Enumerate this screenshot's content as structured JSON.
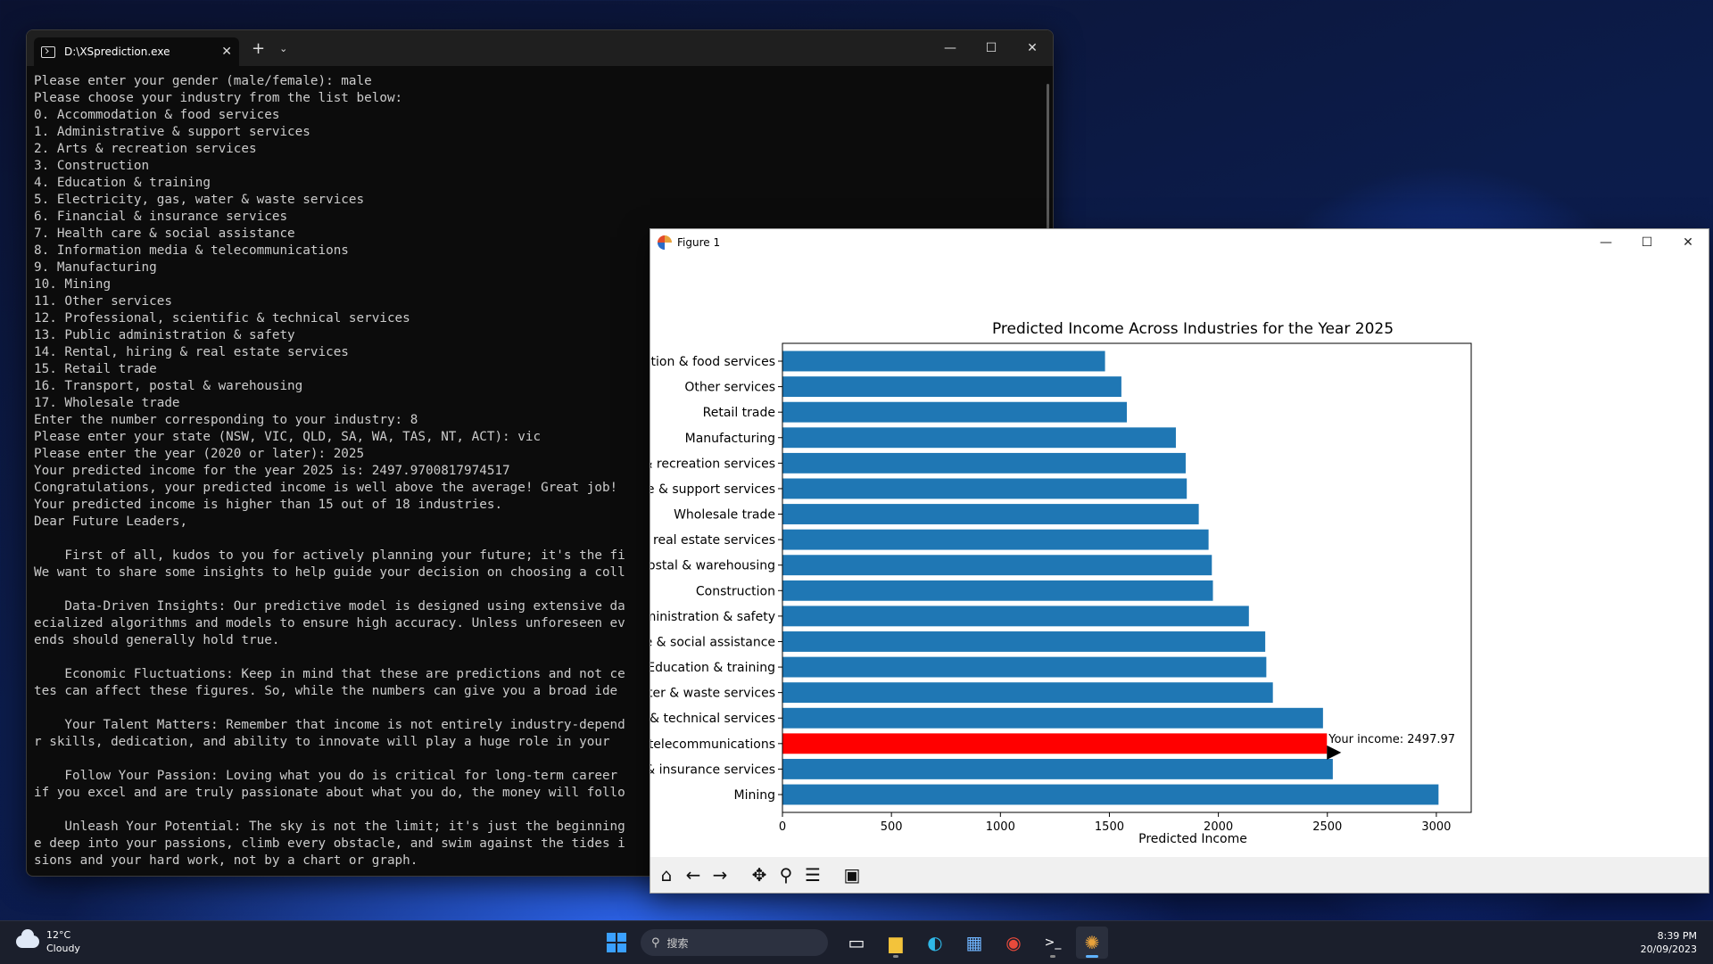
{
  "terminal": {
    "tab_title": "D:\\XSprediction.exe",
    "lines": [
      "Please enter your gender (male/female): male",
      "Please choose your industry from the list below:",
      "0. Accommodation & food services",
      "1. Administrative & support services",
      "2. Arts & recreation services",
      "3. Construction",
      "4. Education & training",
      "5. Electricity, gas, water & waste services",
      "6. Financial & insurance services",
      "7. Health care & social assistance",
      "8. Information media & telecommunications",
      "9. Manufacturing",
      "10. Mining",
      "11. Other services",
      "12. Professional, scientific & technical services",
      "13. Public administration & safety",
      "14. Rental, hiring & real estate services",
      "15. Retail trade",
      "16. Transport, postal & warehousing",
      "17. Wholesale trade",
      "Enter the number corresponding to your industry: 8",
      "Please enter your state (NSW, VIC, QLD, SA, WA, TAS, NT, ACT): vic",
      "Please enter the year (2020 or later): 2025",
      "Your predicted income for the year 2025 is: 2497.9700817974517",
      "Congratulations, your predicted income is well above the average! Great job!",
      "Your predicted income is higher than 15 out of 18 industries.",
      "Dear Future Leaders,",
      "",
      "    First of all, kudos to you for actively planning your future; it's the fi",
      "We want to share some insights to help guide your decision on choosing a coll",
      "",
      "    Data-Driven Insights: Our predictive model is designed using extensive da",
      "ecialized algorithms and models to ensure high accuracy. Unless unforeseen ev",
      "ends should generally hold true.",
      "",
      "    Economic Fluctuations: Keep in mind that these are predictions and not ce",
      "tes can affect these figures. So, while the numbers can give you a broad ide",
      "",
      "    Your Talent Matters: Remember that income is not entirely industry-depend",
      "r skills, dedication, and ability to innovate will play a huge role in your ",
      "",
      "    Follow Your Passion: Loving what you do is critical for long-term career ",
      "if you excel and are truly passionate about what you do, the money will follo",
      "",
      "    Unleash Your Potential: The sky is not the limit; it's just the beginning",
      "e deep into your passions, climb every obstacle, and swim against the tides i",
      "sions and your hard work, not by a chart or graph."
    ]
  },
  "figure": {
    "window_title": "Figure 1"
  },
  "chart_data": {
    "type": "bar",
    "orientation": "horizontal",
    "title": "Predicted Income Across Industries for the Year 2025",
    "xlabel": "Predicted Income",
    "ylabel": "",
    "xlim": [
      0,
      3160
    ],
    "xticks": [
      0,
      500,
      1000,
      1500,
      2000,
      2500,
      3000
    ],
    "categories": [
      "Accommodation & food services",
      "Other services",
      "Retail trade",
      "Manufacturing",
      "Arts & recreation services",
      "Administrative & support services",
      "Wholesale trade",
      "Rental, hiring & real estate services",
      "Transport, postal & warehousing",
      "Construction",
      "Public administration & safety",
      "Health care & social assistance",
      "Education & training",
      "Electricity, gas, water & waste services",
      "Professional, scientific & technical services",
      "Information media & telecommunications",
      "Financial & insurance services",
      "Mining"
    ],
    "values": [
      1480,
      1555,
      1580,
      1805,
      1850,
      1855,
      1910,
      1955,
      1970,
      1975,
      2140,
      2215,
      2220,
      2250,
      2480,
      2497.97,
      2525,
      3010
    ],
    "bar_color": "#1f77b4",
    "highlight_index": 15,
    "highlight_color": "#ff0000",
    "annotation": {
      "text": "Your income: 2497.97",
      "x": 2497.97
    },
    "grid": false
  },
  "taskbar": {
    "weather_temp": "12°C",
    "weather_desc": "Cloudy",
    "search_placeholder": "搜索",
    "time": "8:39 PM",
    "date": "20/09/2023"
  }
}
